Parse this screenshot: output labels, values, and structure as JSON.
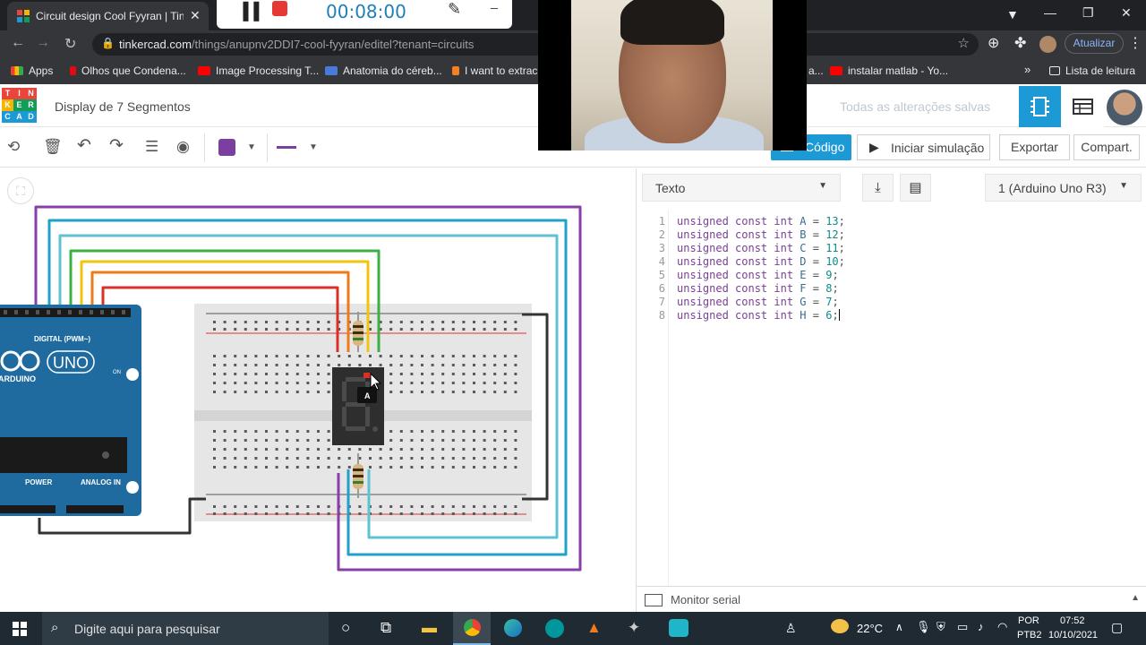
{
  "browser": {
    "tab_title": "Circuit design Cool Fyyran | Tinkercad",
    "url_domain": "tinkercad.com",
    "url_path": "/things/anupnv2DDI7-cool-fyyran/editel?tenant=circuits",
    "update_label": "Atualizar",
    "bookmarks": [
      {
        "label": "Apps",
        "icon_color": "#ea4335"
      },
      {
        "label": "Olhos que Condena...",
        "icon_color": "#e50914"
      },
      {
        "label": "Image Processing T...",
        "icon_color": "#ff0000"
      },
      {
        "label": "Anatomia do cérеb...",
        "icon_color": "#4a7ad9"
      },
      {
        "label": "I want to extrac",
        "icon_color": "#f48024"
      },
      {
        "label": "instalar matlab - Yo...",
        "icon_color": "#ff0000"
      }
    ],
    "bookmarks_more": "»",
    "reading_list": "Lista de leitura",
    "partial_bookmark": "a..."
  },
  "recorder": {
    "timer": "00:08:00"
  },
  "tinkercad": {
    "logo_letters": [
      "T",
      "I",
      "N",
      "K",
      "E",
      "R",
      "C",
      "A",
      "D"
    ],
    "project_title": "Display de 7 Segmentos",
    "saved_status": "Todas as alterações salvas",
    "code_button": "Código",
    "simulate_button": "Iniciar simulação",
    "export_button": "Exportar",
    "share_button": "Compart.",
    "wire_color": "#7a3fa0"
  },
  "code_panel": {
    "mode": "Texto",
    "board": "1 (Arduino Uno R3)",
    "lines": [
      {
        "n": "1",
        "name": "A",
        "value": "13"
      },
      {
        "n": "2",
        "name": "B",
        "value": "12"
      },
      {
        "n": "3",
        "name": "C",
        "value": "11"
      },
      {
        "n": "4",
        "name": "D",
        "value": "10"
      },
      {
        "n": "5",
        "name": "E",
        "value": "9"
      },
      {
        "n": "6",
        "name": "F",
        "value": "8"
      },
      {
        "n": "7",
        "name": "G",
        "value": "7"
      },
      {
        "n": "8",
        "name": "H",
        "value": "6"
      }
    ],
    "keywords": "unsigned const int",
    "serial_monitor": "Monitor serial"
  },
  "circuit": {
    "arduino_brand": "UNO",
    "arduino_label": "ARDUINO",
    "digital_label": "DIGITAL (PWM~)",
    "power_label": "POWER",
    "analog_label": "ANALOG IN",
    "on_label": "ON",
    "tooltip": "A"
  },
  "taskbar": {
    "search_placeholder": "Digite aqui para pesquisar",
    "temperature": "22°C",
    "language": "POR",
    "layout": "PTB2",
    "time": "07:52",
    "date": "10/10/2021"
  }
}
